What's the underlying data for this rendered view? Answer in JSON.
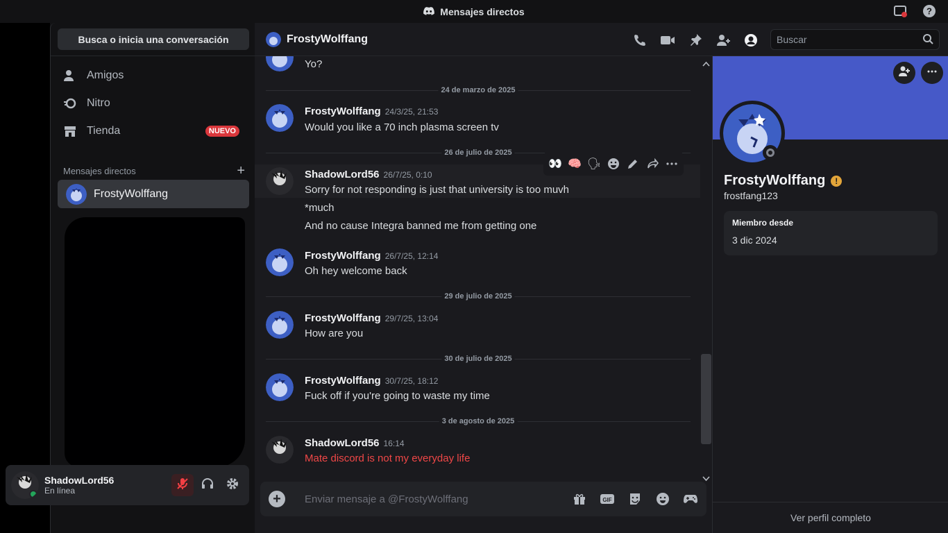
{
  "window": {
    "title": "Mensajes directos"
  },
  "sidebar": {
    "search_label": "Busca o inicia una conversación",
    "nav": [
      {
        "label": "Amigos",
        "icon": "friends-icon"
      },
      {
        "label": "Nitro",
        "icon": "nitro-icon"
      },
      {
        "label": "Tienda",
        "icon": "shop-icon",
        "badge": "NUEVO"
      }
    ],
    "dm_header": "Mensajes directos",
    "dm_items": [
      {
        "name": "FrostyWolffang",
        "active": true
      }
    ]
  },
  "user_bar": {
    "username": "ShadowLord56",
    "status": "En línea"
  },
  "chat": {
    "header_name": "FrostyWolffang",
    "search_placeholder": "Buscar",
    "messages": [
      {
        "type": "partial",
        "text": "Yo?"
      },
      {
        "type": "separator",
        "label": "24 de marzo de 2025"
      },
      {
        "author": "FrostyWolffang",
        "time": "24/3/25, 21:53",
        "lines": [
          "Would you like a 70 inch plasma screen tv"
        ]
      },
      {
        "type": "separator",
        "label": "26 de julio de 2025"
      },
      {
        "author": "ShadowLord56",
        "time": "26/7/25, 0:10",
        "lines": [
          "Sorry for not responding is just that university is too muvh",
          "*much",
          "And no cause Integra banned me from getting one"
        ]
      },
      {
        "author": "FrostyWolffang",
        "time": "26/7/25, 12:14",
        "lines": [
          "Oh hey welcome back"
        ]
      },
      {
        "type": "separator",
        "label": "29 de julio de 2025"
      },
      {
        "author": "FrostyWolffang",
        "time": "29/7/25, 13:04",
        "lines": [
          "How are you"
        ]
      },
      {
        "type": "separator",
        "label": "30 de julio de 2025"
      },
      {
        "author": "FrostyWolffang",
        "time": "30/7/25, 18:12",
        "lines": [
          "Fuck off if you're going to waste my time"
        ]
      },
      {
        "type": "separator",
        "label": "3 de agosto de 2025"
      },
      {
        "author": "ShadowLord56",
        "time": "16:14",
        "lines": [
          "Mate discord is not my everyday life"
        ],
        "color": "#f04747"
      }
    ],
    "composer_placeholder": "Enviar mensaje a @FrostyWolffang"
  },
  "profile": {
    "display_name": "FrostyWolffang",
    "username": "frostfang123",
    "member_since_label": "Miembro desde",
    "member_since": "3 dic 2024",
    "full_profile_label": "Ver perfil completo",
    "banner_color": "#4659c8"
  },
  "colors": {
    "accent": "#5865f2",
    "danger": "#da373c",
    "online": "#23a55a"
  }
}
